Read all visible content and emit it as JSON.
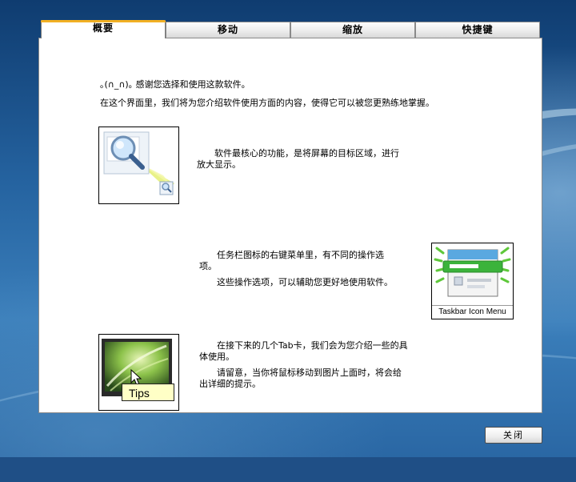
{
  "tabs": [
    {
      "label": "概要",
      "active": true
    },
    {
      "label": "移动",
      "active": false
    },
    {
      "label": "缩放",
      "active": false
    },
    {
      "label": "快捷键",
      "active": false
    }
  ],
  "intro": {
    "line1": "｡(∩_∩)｡ 感谢您选择和使用这款软件。",
    "line2": "在这个界面里，我们将为您介绍软件使用方面的内容，使得它可以被您更熟练地掌握。"
  },
  "sections": {
    "zoom": {
      "line1": "　　软件最核心的功能，是将屏幕的目标区域，进行",
      "line2": "放大显示。"
    },
    "taskbar": {
      "line1": "　　任务栏图标的右键菜单里，有不同的操作选",
      "line2": "项。",
      "line3": "　　这些操作选项，可以辅助您更好地使用软件。",
      "caption": "Taskbar Icon Menu"
    },
    "tips": {
      "line1": "　　在接下来的几个Tab卡，我们会为您介绍一些的具",
      "line2": "体使用。",
      "line3": "　　请留意，当你将鼠标移动到图片上面时，将会给",
      "line4": "出详细的提示。",
      "caption": "Tips"
    }
  },
  "buttons": {
    "close": "关闭"
  }
}
